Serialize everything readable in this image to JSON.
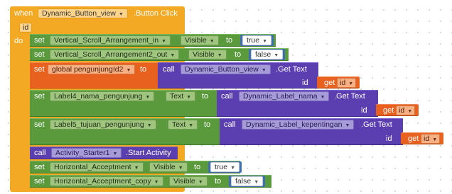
{
  "event": {
    "when": "when",
    "component": "Dynamic_Button_view",
    "event_name": ".Button Click",
    "param": "id",
    "do": "do"
  },
  "rows": {
    "r1": {
      "set": "set",
      "component": "Vertical_Scroll_Arrangement_in",
      "property": "Visible",
      "to": "to",
      "value": "true"
    },
    "r2": {
      "set": "set",
      "component": "Vertical_Scroll_Arrangement2_out",
      "property": "Visible",
      "to": "to",
      "value": "false"
    },
    "r3": {
      "set": "set",
      "variable": "global pengunjungId2",
      "to": "to",
      "call": "call",
      "component": "Dynamic_Button_view",
      "method": ".Get Text",
      "arg_label": "id",
      "get": "get",
      "get_value": "id"
    },
    "r4": {
      "set": "set",
      "component": "Label4_nama_pengunjung",
      "property": "Text",
      "to": "to",
      "call": "call",
      "call_component": "Dynamic_Label_nama",
      "method": ".Get Text",
      "arg_label": "id",
      "get": "get",
      "get_value": "id"
    },
    "r5": {
      "set": "set",
      "component": "Label5_tujuan_pengunjung",
      "property": "Text",
      "to": "to",
      "call": "call",
      "call_component": "Dynamic_Label_kepentingan",
      "method": ".Get Text",
      "arg_label": "id",
      "get": "get",
      "get_value": "id"
    },
    "r6": {
      "call": "call",
      "component": "Activity_Starter1",
      "method": ".Start Activity"
    },
    "r7": {
      "set": "set",
      "component": "Horizontal_Acceptment",
      "property": "Visible",
      "to": "to",
      "value": "true"
    },
    "r8": {
      "set": "set",
      "component": "Horizontal_Acceptment_copy",
      "property": "Visible",
      "to": "to",
      "value": "false"
    }
  },
  "dropdown_icon": "triangle-down",
  "colors": {
    "event": "#f4a925",
    "set": "#5a9a3c",
    "call": "#5b3fb1",
    "get": "#e8611f",
    "logic": "#3f6fb0"
  }
}
